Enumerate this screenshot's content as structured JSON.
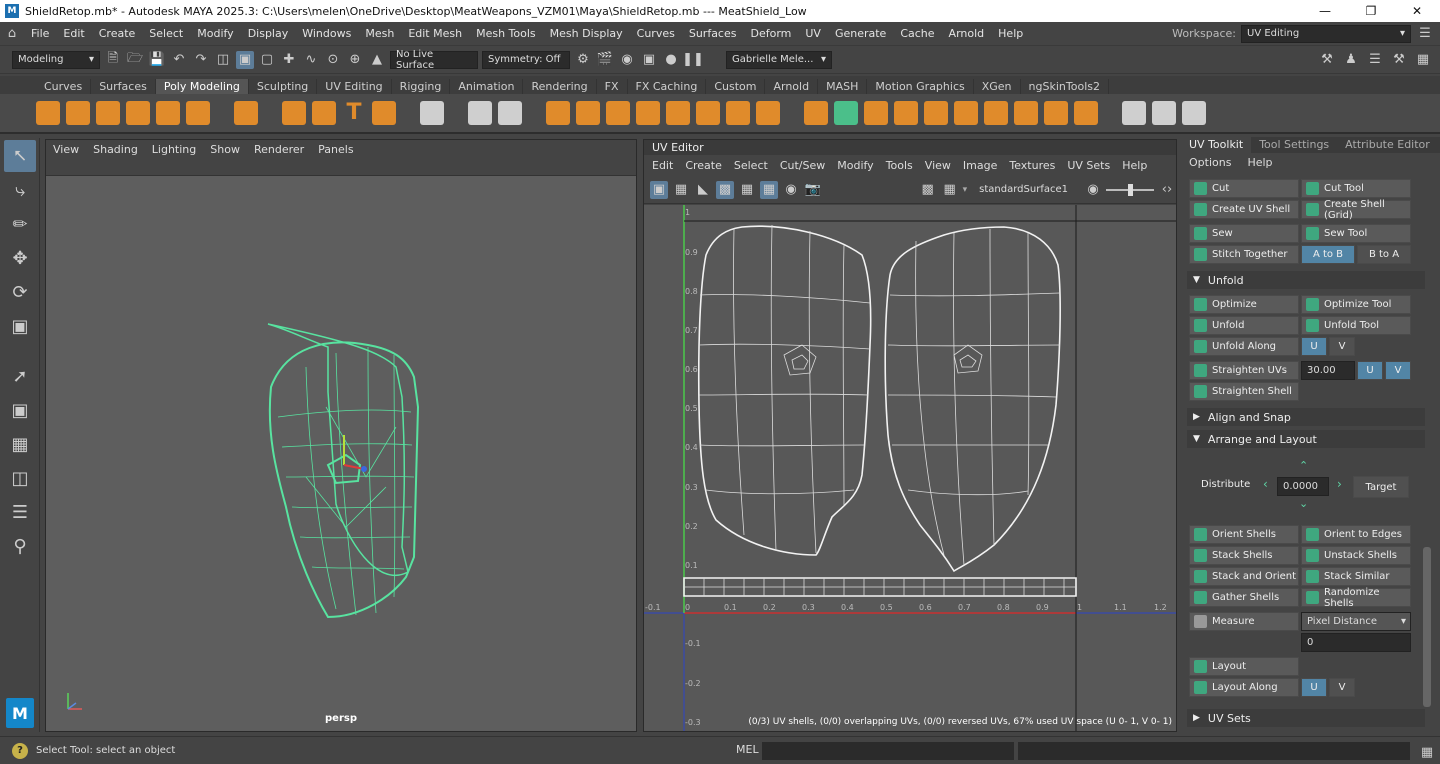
{
  "title_bar": {
    "title": "ShieldRetop.mb* - Autodesk MAYA 2025.3: C:\\Users\\melen\\OneDrive\\Desktop\\MeatWeapons_VZM01\\Maya\\ShieldRetop.mb   ---   MeatShield_Low",
    "buttons": [
      "minimize-icon",
      "restore-icon",
      "close-icon"
    ]
  },
  "menu": {
    "items": [
      "File",
      "Edit",
      "Create",
      "Select",
      "Modify",
      "Display",
      "Windows",
      "Mesh",
      "Edit Mesh",
      "Mesh Tools",
      "Mesh Display",
      "Curves",
      "Surfaces",
      "Deform",
      "UV",
      "Generate",
      "Cache",
      "Arnold",
      "Help"
    ],
    "workspace_label": "Workspace:",
    "workspace_value": "UV Editing"
  },
  "status_line": {
    "mode": "Modeling",
    "live_surface": "No Live Surface",
    "symmetry": "Symmetry: Off",
    "user": "Gabrielle Mele..."
  },
  "shelf": {
    "tabs": [
      "Curves",
      "Surfaces",
      "Poly Modeling",
      "Sculpting",
      "UV Editing",
      "Rigging",
      "Animation",
      "Rendering",
      "FX",
      "FX Caching",
      "Custom",
      "Arnold",
      "MASH",
      "Motion Graphics",
      "XGen",
      "ngSkinTools2"
    ],
    "active_tab": "Poly Modeling"
  },
  "viewport": {
    "menus": [
      "View",
      "Shading",
      "Lighting",
      "Show",
      "Renderer",
      "Panels"
    ],
    "camera": "persp"
  },
  "uv_editor": {
    "title": "UV Editor",
    "menus": [
      "Edit",
      "Create",
      "Select",
      "Cut/Sew",
      "Modify",
      "Tools",
      "View",
      "Image",
      "Textures",
      "UV Sets",
      "Help"
    ],
    "material": "standardSurface1",
    "v_ticks": [
      "1",
      "0.9",
      "0.8",
      "0.7",
      "0.6",
      "0.5",
      "0.4",
      "0.3",
      "0.2",
      "0.1",
      "-0.1",
      "-0.2",
      "-0.3"
    ],
    "u_ticks": [
      "-0.1",
      "0",
      "0.1",
      "0.2",
      "0.3",
      "0.4",
      "0.5",
      "0.6",
      "0.7",
      "0.8",
      "0.9",
      "1",
      "1.1",
      "1.2"
    ],
    "info": "(0/3) UV shells, (0/0) overlapping UVs, (0/0) reversed UVs, 67% used UV space (U  0- 1, V  0- 1)"
  },
  "toolkit": {
    "tabs": [
      "UV Toolkit",
      "Tool Settings",
      "Attribute Editor"
    ],
    "menus": [
      "Options",
      "Help"
    ],
    "buttons": {
      "cut": "Cut",
      "cut_tool": "Cut Tool",
      "create_uv_shell": "Create UV Shell",
      "create_shell_grid": "Create Shell (Grid)",
      "sew": "Sew",
      "sew_tool": "Sew Tool",
      "stitch_together": "Stitch Together",
      "a_to_b": "A to B",
      "b_to_a": "B to A",
      "optimize": "Optimize",
      "optimize_tool": "Optimize Tool",
      "unfold": "Unfold",
      "unfold_tool": "Unfold Tool",
      "unfold_along": "Unfold Along",
      "u": "U",
      "v": "V",
      "straighten_uvs": "Straighten UVs",
      "straighten_value": "30.00",
      "straighten_shell": "Straighten Shell",
      "orient_shells": "Orient Shells",
      "orient_to_edges": "Orient to Edges",
      "stack_shells": "Stack Shells",
      "unstack_shells": "Unstack Shells",
      "stack_and_orient": "Stack and Orient",
      "stack_similar": "Stack Similar",
      "gather_shells": "Gather Shells",
      "randomize_shells": "Randomize Shells",
      "measure": "Measure",
      "measure_mode": "Pixel Distance",
      "measure_value": "0",
      "layout": "Layout",
      "layout_along": "Layout Along",
      "distribute": "Distribute",
      "distribute_value": "0.0000",
      "target": "Target"
    },
    "sections": {
      "unfold": "Unfold",
      "align": "Align and Snap",
      "arrange": "Arrange and Layout",
      "uvsets": "UV Sets"
    }
  },
  "help_line": {
    "text": "Select Tool: select an object",
    "mel_label": "MEL"
  }
}
